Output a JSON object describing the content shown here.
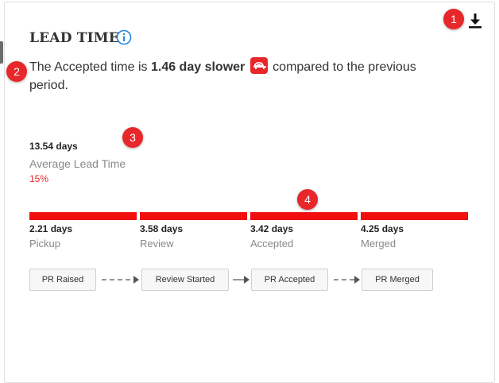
{
  "widget": {
    "title": "LEAD TIME",
    "summary": {
      "prefix": "The Accepted time is",
      "emphasis": "1.46 day slower",
      "suffix": "compared to the previous period."
    },
    "average": {
      "value": "13.54 days",
      "label": "Average Lead Time",
      "change": "15%"
    },
    "stages": [
      {
        "days": "2.21 days",
        "name": "Pickup"
      },
      {
        "days": "3.58 days",
        "name": "Review"
      },
      {
        "days": "3.42 days",
        "name": "Accepted"
      },
      {
        "days": "4.25 days",
        "name": "Merged"
      }
    ],
    "flow": [
      "PR Raised",
      "Review Started",
      "PR Accepted",
      "PR Merged"
    ]
  },
  "markers": [
    "1",
    "2",
    "3",
    "4"
  ],
  "icons": {
    "info": "info-icon",
    "download": "download-icon",
    "slow": "turtle-icon"
  },
  "colors": {
    "accent": "#e8272b",
    "bar": "#f20f0f",
    "info": "#1e88e5"
  }
}
